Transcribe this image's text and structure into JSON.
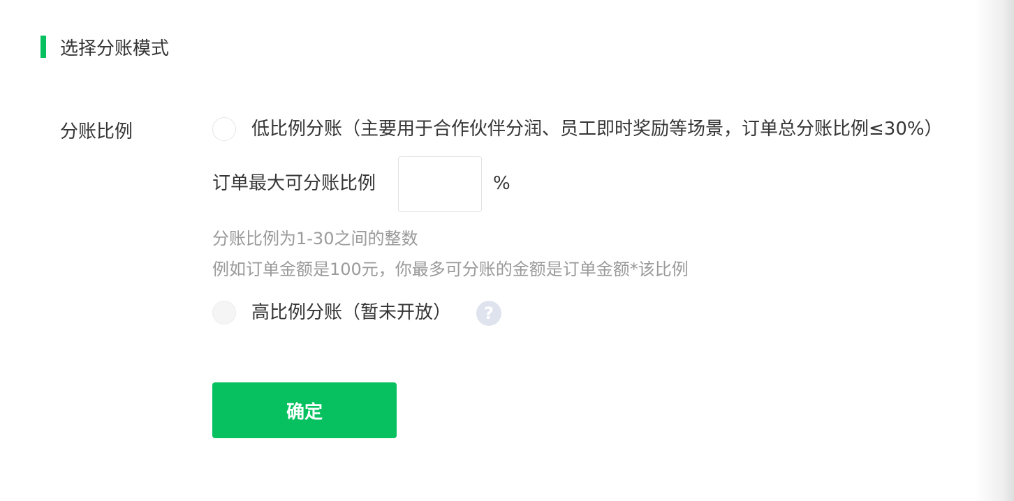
{
  "section": {
    "title": "选择分账模式",
    "accent_color": "#07c160"
  },
  "form": {
    "field_label": "分账比例",
    "options": [
      {
        "label": "低比例分账（主要用于合作伙伴分润、员工即时奖励等场景，订单总分账比例≤30%）",
        "selected": false,
        "disabled": false
      },
      {
        "label": "高比例分账（暂未开放）",
        "selected": false,
        "disabled": true
      }
    ],
    "ratio": {
      "label": "订单最大可分账比例",
      "value": "",
      "unit": "%"
    },
    "tips": [
      "分账比例为1-30之间的整数",
      "例如订单金额是100元，你最多可分账的金额是订单金额*该比例"
    ],
    "help_icon": {
      "icon": "question-mark-icon",
      "glyph": "?"
    },
    "confirm_label": "确定"
  }
}
